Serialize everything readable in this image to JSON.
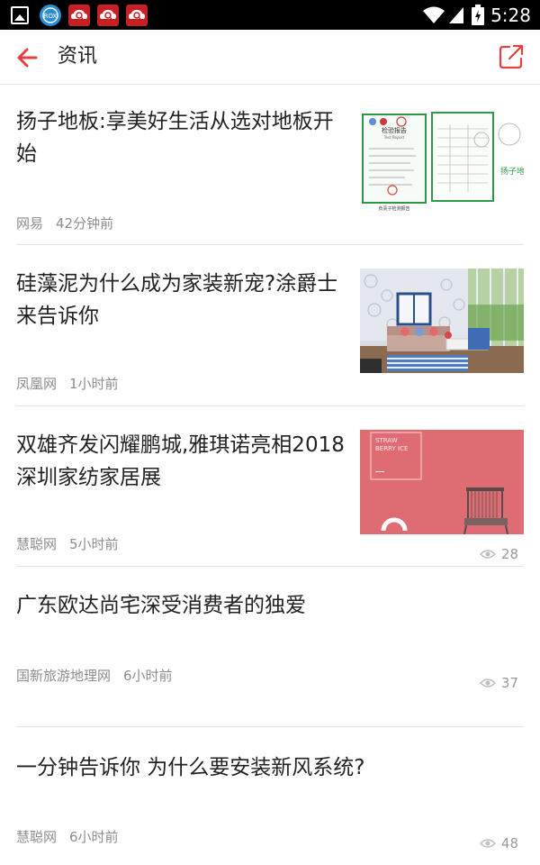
{
  "status_bar": {
    "time": "5:28",
    "icons": [
      "gallery-icon",
      "app-icon",
      "cloud-search-icon",
      "cloud-search-icon",
      "cloud-search-icon",
      "wifi-icon",
      "signal-icon",
      "battery-icon"
    ]
  },
  "header": {
    "title": "资讯",
    "back_icon": "arrow-left-icon",
    "share_icon": "share-icon",
    "accent_color": "#e5403b"
  },
  "news": [
    {
      "title": "扬子地板:享美好生活从选对地板开始",
      "source": "网易",
      "time": "42分钟前",
      "views": null,
      "thumb": "report-documents",
      "thumb_text": {
        "report_title": "检验报告",
        "report_subtitle": "Test Report",
        "caption": "负责子检测报告",
        "side_text": "扬子地 真环保 环保"
      }
    },
    {
      "title": "硅藻泥为什么成为家装新宠?涂爵士来告诉你",
      "source": "凤凰网",
      "time": "1小时前",
      "views": null,
      "thumb": "living-room"
    },
    {
      "title": "双雄齐发闪耀鹏城,雅琪诺亮相2018深圳家纺家居展",
      "source": "慧聪网",
      "time": "5小时前",
      "views": "28",
      "thumb": "pink-chair",
      "thumb_text": {
        "line1": "STRAW",
        "line2": "BERRY ICE"
      }
    },
    {
      "title": "广东欧达尚宅深受消费者的独爱",
      "source": "国新旅游地理网",
      "time": "6小时前",
      "views": "37",
      "thumb": null
    },
    {
      "title": "一分钟告诉你 为什么要安装新风系统?",
      "source": "慧聪网",
      "time": "6小时前",
      "views": "48",
      "thumb": null
    }
  ]
}
